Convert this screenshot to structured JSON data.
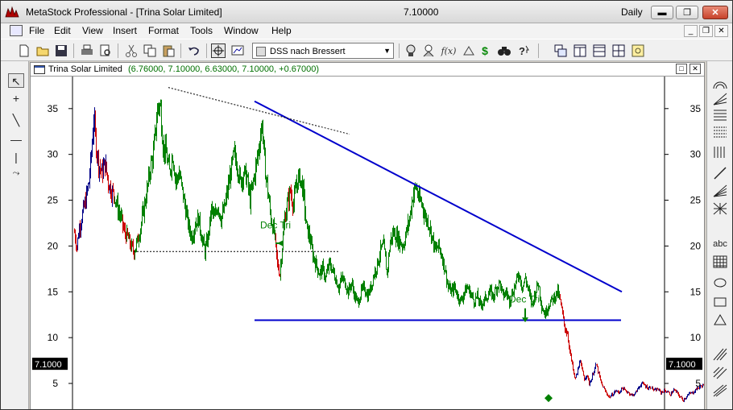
{
  "window": {
    "app_title": "MetaStock Professional - [Trina Solar Limited]",
    "last_price": "7.10000",
    "periodicity": "Daily",
    "min_glyph": "▬",
    "max_glyph": "❐",
    "close_glyph": "✕"
  },
  "menu": {
    "items": [
      "File",
      "Edit",
      "View",
      "Insert",
      "Format",
      "Tools",
      "Window",
      "Help"
    ],
    "mdi_min": "_",
    "mdi_restore": "❐",
    "mdi_close": "✕"
  },
  "toolbar": {
    "expert_name": "DSS nach Bressert",
    "expert_arrow": "▼",
    "icons": [
      "new-icon",
      "open-icon",
      "save-icon",
      "print-icon",
      "print-preview-icon",
      "cut-icon",
      "copy-icon",
      "paste-icon",
      "undo-icon",
      "crosshair-icon",
      "expert-icon",
      "explorer-icon",
      "indicator-builder-icon",
      "system-tester-icon",
      "binoculars-icon",
      "help-icon",
      "window-cascade-icon",
      "tile-vertical-icon",
      "tile-horizontal-icon",
      "tile-icon",
      "chart-settings-icon"
    ],
    "glyphs": {
      "fx": "f(x)",
      "dollar": "$",
      "help": "❓"
    }
  },
  "left_tools": {
    "glyphs": [
      "↖",
      "+",
      "╲",
      "—",
      "|",
      "⤳"
    ]
  },
  "right_tools": {
    "text_label": "abc"
  },
  "chart_window": {
    "security_name": "Trina Solar Limited",
    "ohlc_text": "(6.76000, 7.10000, 6.63000, 7.10000, +0.67000)",
    "max_glyph": "□",
    "close_glyph": "✕"
  },
  "chart_data": {
    "type": "bar",
    "title": "Trina Solar Limited",
    "y_ticks": [
      35,
      30,
      25,
      20,
      15,
      10,
      5
    ],
    "ylim": [
      2.1,
      38.5
    ],
    "axis_labels_both_sides": true,
    "last_price_marker": "7.1000",
    "colors": {
      "up": "#008000",
      "down": "#cc0000",
      "neutral": "#000088",
      "trendline": "#0000cc",
      "dotted": "#000000",
      "label": "#008000"
    },
    "price_path": [
      [
        0,
        21.5
      ],
      [
        3,
        20.0
      ],
      [
        6,
        22.0
      ],
      [
        10,
        23.5
      ],
      [
        14,
        25.0
      ],
      [
        18,
        27.0
      ],
      [
        21,
        30.0
      ],
      [
        24,
        34.0
      ],
      [
        27,
        31.0
      ],
      [
        30,
        29.0
      ],
      [
        34,
        28.0
      ],
      [
        38,
        29.0
      ],
      [
        42,
        27.0
      ],
      [
        46,
        26.0
      ],
      [
        50,
        25.5
      ],
      [
        54,
        24.0
      ],
      [
        58,
        23.0
      ],
      [
        62,
        21.5
      ],
      [
        66,
        21.0
      ],
      [
        70,
        20.0
      ],
      [
        74,
        19.4
      ],
      [
        78,
        20.5
      ],
      [
        82,
        22.0
      ],
      [
        86,
        24.0
      ],
      [
        90,
        26.0
      ],
      [
        94,
        28.5
      ],
      [
        98,
        30.0
      ],
      [
        101,
        33.0
      ],
      [
        104,
        35.5
      ],
      [
        107,
        35.0
      ],
      [
        110,
        31.0
      ],
      [
        114,
        30.0
      ],
      [
        118,
        28.0
      ],
      [
        122,
        30.0
      ],
      [
        126,
        27.0
      ],
      [
        130,
        28.0
      ],
      [
        134,
        26.0
      ],
      [
        138,
        24.0
      ],
      [
        142,
        22.0
      ],
      [
        146,
        21.0
      ],
      [
        150,
        22.5
      ],
      [
        154,
        23.0
      ],
      [
        158,
        21.0
      ],
      [
        162,
        19.4
      ],
      [
        166,
        21.0
      ],
      [
        170,
        24.0
      ],
      [
        174,
        23.0
      ],
      [
        178,
        24.5
      ],
      [
        182,
        23.0
      ],
      [
        186,
        24.0
      ],
      [
        190,
        26.0
      ],
      [
        194,
        28.0
      ],
      [
        198,
        30.0
      ],
      [
        202,
        29.0
      ],
      [
        206,
        27.0
      ],
      [
        210,
        28.0
      ],
      [
        214,
        27.5
      ],
      [
        218,
        25.0
      ],
      [
        222,
        27.0
      ],
      [
        226,
        29.0
      ],
      [
        230,
        31.5
      ],
      [
        233,
        33.5
      ],
      [
        236,
        29.0
      ],
      [
        240,
        26.0
      ],
      [
        244,
        23.0
      ],
      [
        248,
        21.5
      ],
      [
        252,
        18.0
      ],
      [
        255,
        17.0
      ],
      [
        258,
        20.0
      ],
      [
        261,
        23.0
      ],
      [
        264,
        24.5
      ],
      [
        268,
        26.0
      ],
      [
        272,
        24.5
      ],
      [
        276,
        27.0
      ],
      [
        280,
        27.5
      ],
      [
        284,
        26.0
      ],
      [
        288,
        22.0
      ],
      [
        292,
        21.0
      ],
      [
        296,
        19.0
      ],
      [
        300,
        18.0
      ],
      [
        304,
        17.0
      ],
      [
        308,
        17.5
      ],
      [
        312,
        16.5
      ],
      [
        316,
        18.0
      ],
      [
        320,
        17.5
      ],
      [
        324,
        16.5
      ],
      [
        328,
        15.5
      ],
      [
        332,
        16.5
      ],
      [
        336,
        16.0
      ],
      [
        340,
        15.0
      ],
      [
        344,
        16.0
      ],
      [
        348,
        14.5
      ],
      [
        352,
        13.8
      ],
      [
        356,
        15.0
      ],
      [
        360,
        15.5
      ],
      [
        364,
        14.5
      ],
      [
        368,
        15.5
      ],
      [
        372,
        17.0
      ],
      [
        376,
        18.0
      ],
      [
        380,
        19.5
      ],
      [
        384,
        20.0
      ],
      [
        388,
        17.0
      ],
      [
        392,
        20.5
      ],
      [
        396,
        21.5
      ],
      [
        400,
        21.0
      ],
      [
        404,
        20.5
      ],
      [
        408,
        20.0
      ],
      [
        412,
        21.5
      ],
      [
        416,
        23.0
      ],
      [
        420,
        25.5
      ],
      [
        424,
        26.5
      ],
      [
        428,
        25.0
      ],
      [
        432,
        24.5
      ],
      [
        436,
        23.0
      ],
      [
        440,
        22.5
      ],
      [
        444,
        21.0
      ],
      [
        448,
        19.5
      ],
      [
        452,
        20.0
      ],
      [
        456,
        19.0
      ],
      [
        460,
        17.5
      ],
      [
        464,
        15.5
      ],
      [
        468,
        15.0
      ],
      [
        472,
        15.5
      ],
      [
        476,
        14.5
      ],
      [
        480,
        14.0
      ],
      [
        484,
        15.0
      ],
      [
        488,
        15.5
      ],
      [
        492,
        14.8
      ],
      [
        496,
        14.0
      ],
      [
        500,
        14.5
      ],
      [
        504,
        13.5
      ],
      [
        508,
        14.0
      ],
      [
        512,
        14.5
      ],
      [
        516,
        15.0
      ],
      [
        520,
        14.5
      ],
      [
        524,
        15.5
      ],
      [
        528,
        16.0
      ],
      [
        532,
        14.5
      ],
      [
        536,
        15.0
      ],
      [
        540,
        14.0
      ],
      [
        544,
        15.0
      ],
      [
        548,
        16.0
      ],
      [
        552,
        17.0
      ],
      [
        556,
        15.5
      ],
      [
        560,
        16.5
      ],
      [
        564,
        15.0
      ],
      [
        568,
        13.5
      ],
      [
        572,
        15.0
      ],
      [
        576,
        16.0
      ],
      [
        580,
        13.5
      ],
      [
        584,
        12.5
      ],
      [
        588,
        13.5
      ],
      [
        592,
        14.0
      ],
      [
        596,
        14.5
      ],
      [
        600,
        15.0
      ],
      [
        603,
        14.0
      ],
      [
        606,
        12.5
      ],
      [
        609,
        11.0
      ],
      [
        612,
        10.5
      ],
      [
        615,
        8.5
      ],
      [
        618,
        7.0
      ],
      [
        621,
        5.5
      ],
      [
        624,
        6.0
      ],
      [
        627,
        7.5
      ],
      [
        630,
        6.5
      ],
      [
        633,
        5.5
      ],
      [
        636,
        6.0
      ],
      [
        639,
        5.0
      ],
      [
        642,
        5.5
      ],
      [
        645,
        6.5
      ],
      [
        648,
        7.0
      ],
      [
        651,
        6.0
      ],
      [
        654,
        5.0
      ],
      [
        657,
        4.5
      ],
      [
        660,
        4.0
      ],
      [
        664,
        3.5
      ],
      [
        668,
        3.8
      ],
      [
        672,
        4.2
      ],
      [
        676,
        4.0
      ],
      [
        680,
        4.5
      ],
      [
        684,
        4.2
      ],
      [
        688,
        4.0
      ],
      [
        692,
        3.7
      ],
      [
        696,
        3.9
      ],
      [
        700,
        4.5
      ],
      [
        704,
        5.0
      ],
      [
        708,
        4.8
      ],
      [
        712,
        4.5
      ],
      [
        716,
        4.6
      ],
      [
        720,
        4.2
      ],
      [
        724,
        4.4
      ],
      [
        728,
        4.0
      ],
      [
        732,
        4.2
      ],
      [
        736,
        4.1
      ],
      [
        740,
        3.8
      ],
      [
        744,
        4.3
      ],
      [
        748,
        4.0
      ],
      [
        752,
        3.5
      ],
      [
        756,
        3.2
      ],
      [
        760,
        3.6
      ],
      [
        764,
        3.9
      ],
      [
        768,
        4.0
      ],
      [
        772,
        4.4
      ],
      [
        776,
        4.6
      ],
      [
        780,
        4.8
      ],
      [
        784,
        5.0
      ]
    ],
    "annotations": [
      {
        "label": "Dec Tri"
      },
      {
        "label": "Dec Tri"
      }
    ]
  }
}
